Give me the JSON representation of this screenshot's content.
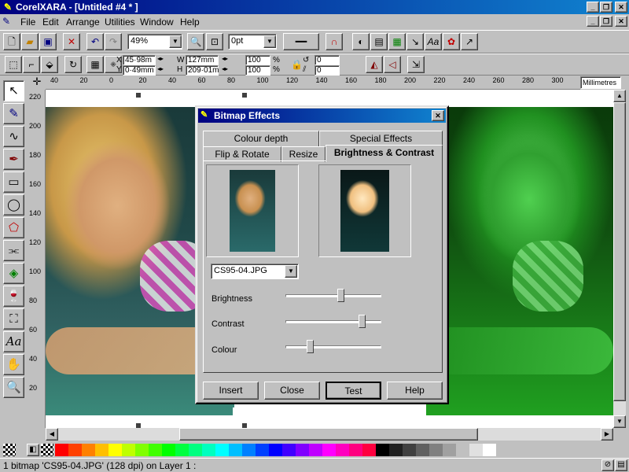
{
  "window": {
    "title": "CorelXARA - [Untitled #4 * ]"
  },
  "menu": [
    "File",
    "Edit",
    "Arrange",
    "Utilities",
    "Window",
    "Help"
  ],
  "toolbar": {
    "zoom_value": "49%",
    "outline_width": "0pt",
    "x_value": "45·98m",
    "y_value": "0·49mm",
    "w_value": "127mm",
    "h_value": "209·01m",
    "scale_x": "100",
    "scale_y": "100",
    "rotate_value": "0",
    "skew_value": "0",
    "x_label": "X",
    "y_label": "Y",
    "w_label": "W",
    "h_label": "H",
    "percent": "%"
  },
  "ruler": {
    "units": "Millimetres",
    "h_ticks": [
      "40",
      "20",
      "0",
      "20",
      "40",
      "60",
      "80",
      "100",
      "120",
      "140",
      "160",
      "180",
      "200",
      "220",
      "240",
      "260",
      "280",
      "300"
    ],
    "v_ticks": [
      "220",
      "200",
      "180",
      "160",
      "140",
      "120",
      "100",
      "80",
      "60",
      "40",
      "20"
    ]
  },
  "dialog": {
    "title": "Bitmap Effects",
    "tabs_back": [
      "Colour depth",
      "Special Effects"
    ],
    "tabs_front": [
      "Flip & Rotate",
      "Resize",
      "Brightness & Contrast"
    ],
    "file_select": "CS95-04.JPG",
    "sliders": [
      {
        "label": "Brightness",
        "value": 0.58
      },
      {
        "label": "Contrast",
        "value": 0.82
      },
      {
        "label": "Colour",
        "value": 0.24
      }
    ],
    "buttons": [
      "Insert",
      "Close",
      "Test",
      "Help"
    ]
  },
  "palette": [
    "#ff0000",
    "#ff4000",
    "#ff8000",
    "#ffbf00",
    "#ffff00",
    "#bfff00",
    "#80ff00",
    "#40ff00",
    "#00ff00",
    "#00ff40",
    "#00ff80",
    "#00ffbf",
    "#00ffff",
    "#00bfff",
    "#0080ff",
    "#0040ff",
    "#0000ff",
    "#4000ff",
    "#8000ff",
    "#bf00ff",
    "#ff00ff",
    "#ff00bf",
    "#ff0080",
    "#ff0040",
    "#000000",
    "#202020",
    "#404040",
    "#606060",
    "#808080",
    "#a0a0a0",
    "#c0c0c0",
    "#e0e0e0",
    "#ffffff"
  ],
  "status": {
    "text": "1 bitmap 'CS95-04.JPG' (128 dpi) on Layer 1 :"
  }
}
